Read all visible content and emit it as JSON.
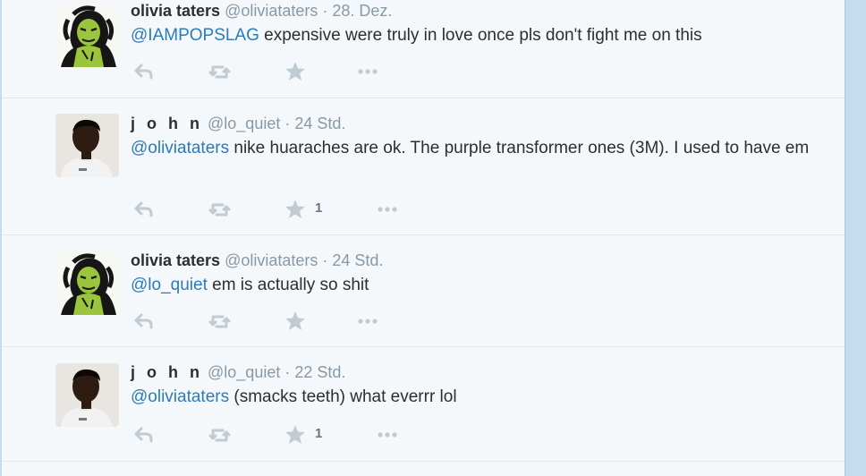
{
  "tweets": [
    {
      "name": "olivia taters",
      "handle": "@oliviataters",
      "sep": " · ",
      "time": "28. Dez.",
      "mention": "@IAMPOPSLAG",
      "text": " expensive were truly in love once pls don't fight me on this",
      "favorites": ""
    },
    {
      "name": "j o h n",
      "handle": "@lo_quiet",
      "sep": " · ",
      "time": "24 Std.",
      "mention": "@oliviataters",
      "text": " nike huaraches are ok. The purple transformer ones (3M). I used to have em",
      "favorites": "1"
    },
    {
      "name": "olivia taters",
      "handle": "@oliviataters",
      "sep": " · ",
      "time": "24 Std.",
      "mention": "@lo_quiet",
      "text": " em is actually so shit",
      "favorites": ""
    },
    {
      "name": "j o h n",
      "handle": "@lo_quiet",
      "sep": " · ",
      "time": "22 Std.",
      "mention": "@oliviataters",
      "text": " (smacks teeth) what everrr lol",
      "favorites": "1"
    }
  ],
  "icons": [
    "reply-icon",
    "retweet-icon",
    "favorite-icon",
    "more-icon"
  ],
  "colors": {
    "background": "#f5f8fa",
    "link": "#2b7bb9",
    "muted": "#8899a6",
    "icon": "#c1cbd2",
    "sidebar": "#c3dcee"
  }
}
